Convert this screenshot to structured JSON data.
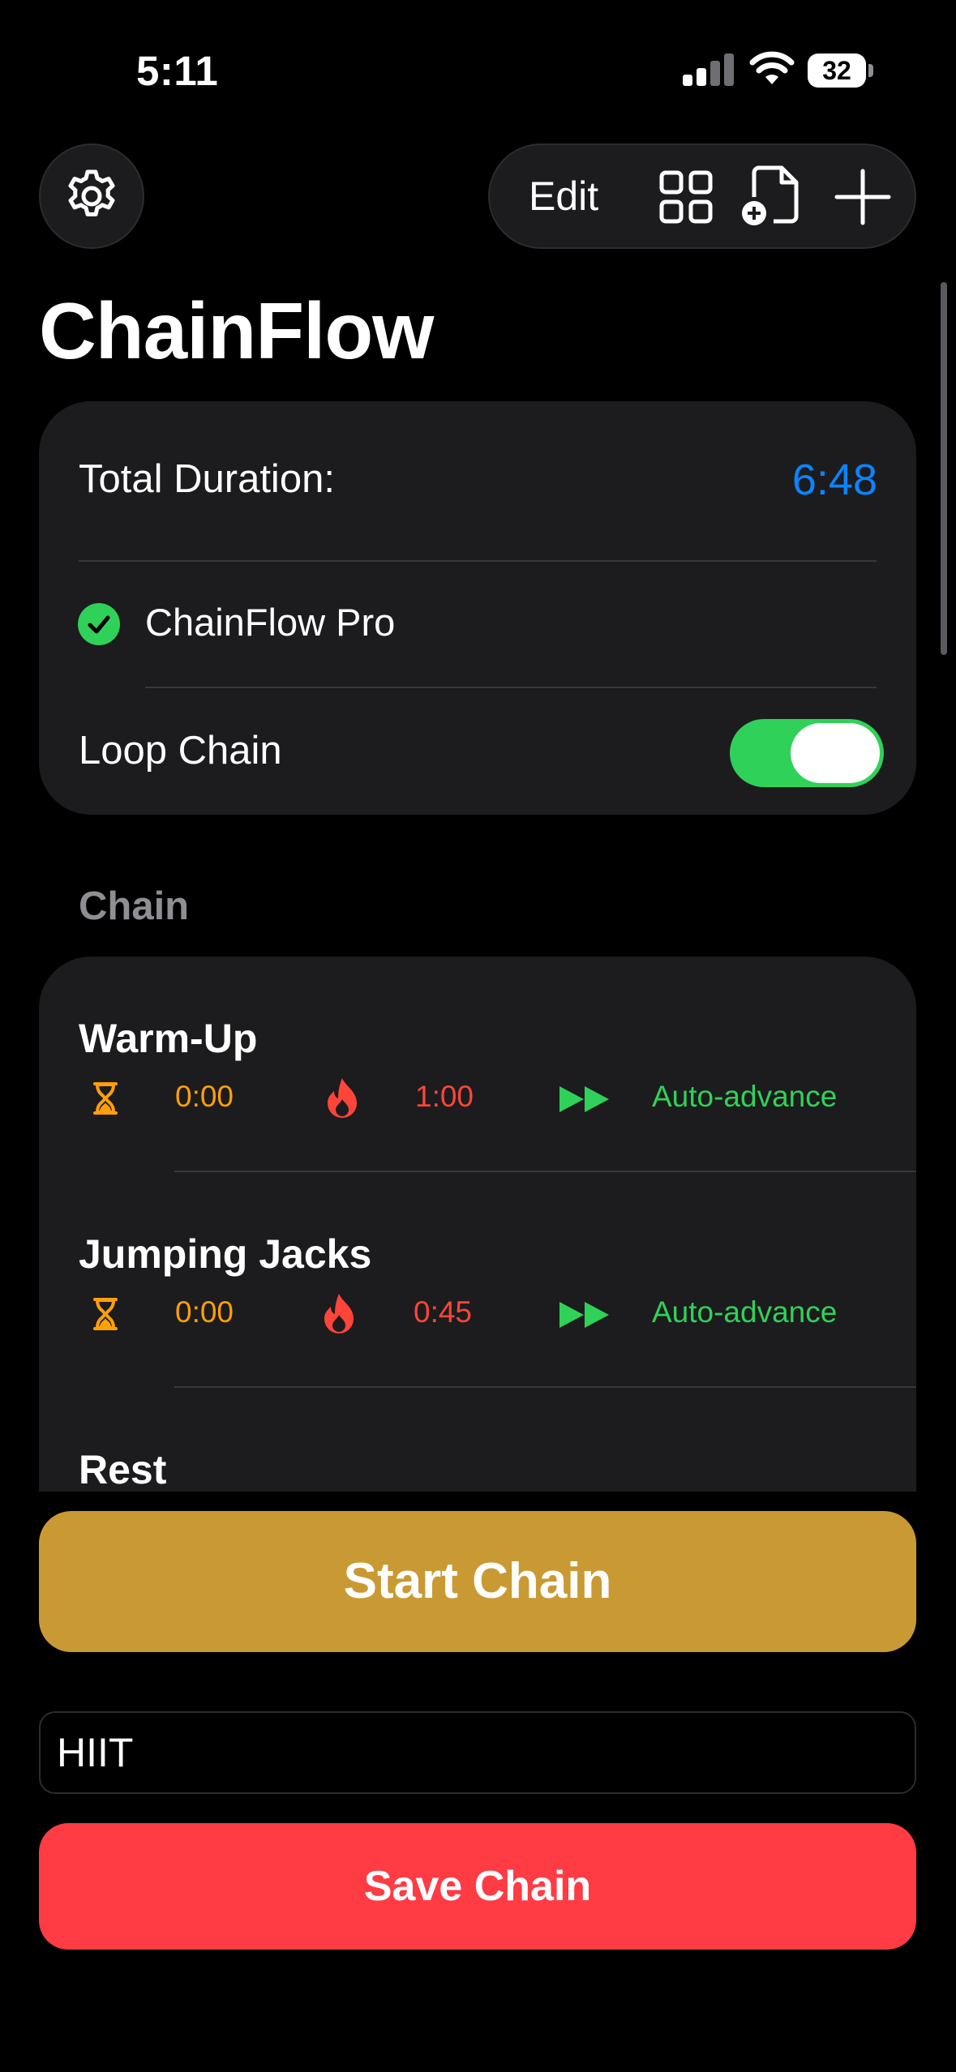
{
  "status_bar": {
    "time": "5:11",
    "battery": "32"
  },
  "toolbar": {
    "edit_label": "Edit",
    "icons": [
      "gear-icon",
      "grid-icon",
      "doc-add-icon",
      "plus-icon"
    ]
  },
  "app_title": "ChainFlow",
  "summary": {
    "duration_label": "Total Duration:",
    "duration_value": "6:48",
    "pro_label": "ChainFlow Pro",
    "loop_label": "Loop Chain",
    "loop_enabled": true
  },
  "chain": {
    "section_title": "Chain",
    "steps": [
      {
        "name": "Warm-Up",
        "timer": "0:00",
        "duration": "1:00",
        "mode": "Auto-advance"
      },
      {
        "name": "Jumping Jacks",
        "timer": "0:00",
        "duration": "0:45",
        "mode": "Auto-advance"
      },
      {
        "name": "Rest"
      }
    ]
  },
  "actions": {
    "start_label": "Start Chain",
    "chain_name_value": "HIIT",
    "save_label": "Save Chain"
  },
  "colors": {
    "accent_blue": "#0a84ff",
    "green": "#30d158",
    "orange": "#ff9f0a",
    "red": "#ff453a",
    "start_button": "#c99a33",
    "save_button": "#ff3b44"
  }
}
